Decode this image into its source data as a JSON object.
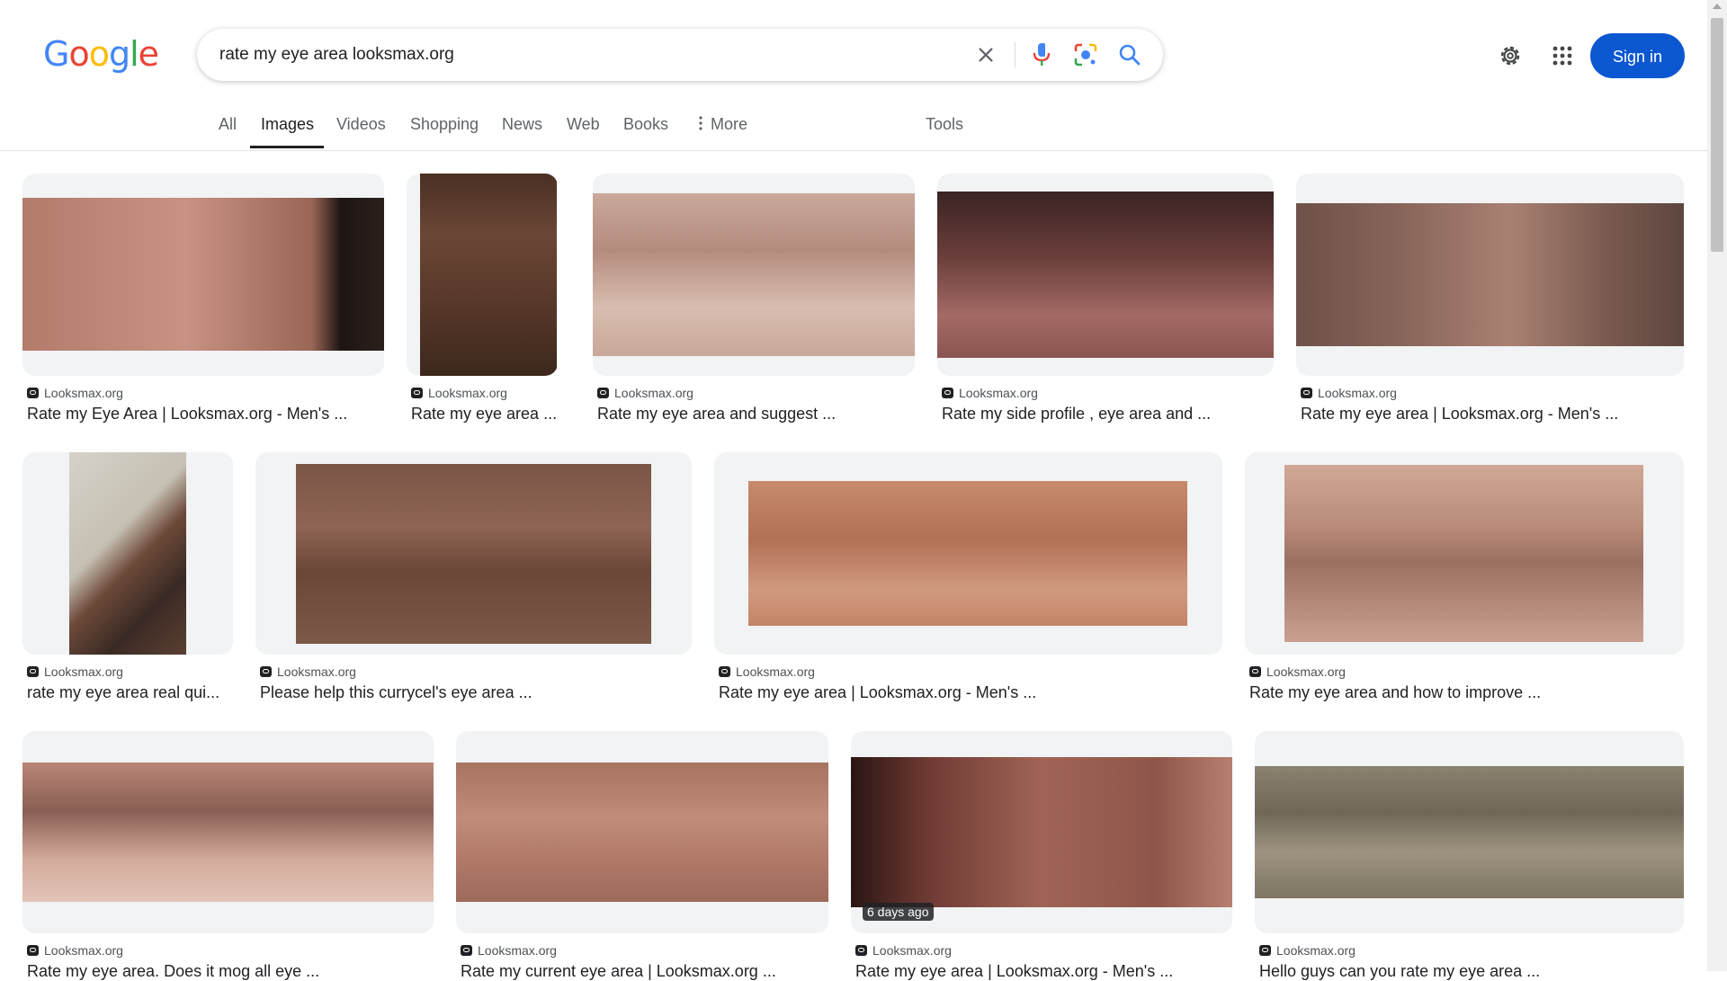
{
  "logo_text": "Google",
  "search": {
    "query": "rate my eye area looksmax.org"
  },
  "header": {
    "signin_label": "Sign in"
  },
  "tabs": [
    {
      "label": "All"
    },
    {
      "label": "Images"
    },
    {
      "label": "Videos"
    },
    {
      "label": "Shopping"
    },
    {
      "label": "News"
    },
    {
      "label": "Web"
    },
    {
      "label": "Books"
    },
    {
      "label": "More"
    },
    {
      "label": "Tools"
    }
  ],
  "results": [
    {
      "source": "Looksmax.org",
      "title": "Rate my Eye Area | Looksmax.org - Men's ..."
    },
    {
      "source": "Looksmax.org",
      "title": "Rate my eye area ..."
    },
    {
      "source": "Looksmax.org",
      "title": "Rate my eye area and suggest ..."
    },
    {
      "source": "Looksmax.org",
      "title": "Rate my side profile , eye area and ..."
    },
    {
      "source": "Looksmax.org",
      "title": "Rate my eye area | Looksmax.org - Men's ..."
    },
    {
      "source": "Looksmax.org",
      "title": "rate my eye area real qui..."
    },
    {
      "source": "Looksmax.org",
      "title": "Please help this currycel's eye area ..."
    },
    {
      "source": "Looksmax.org",
      "title": "Rate my eye area | Looksmax.org - Men's ..."
    },
    {
      "source": "Looksmax.org",
      "title": "Rate my eye area and how to improve ..."
    },
    {
      "source": "Looksmax.org",
      "title": "Rate my eye area. Does it mog all eye ..."
    },
    {
      "source": "Looksmax.org",
      "title": "Rate my current eye area | Looksmax.org ..."
    },
    {
      "source": "Looksmax.org",
      "title": "Rate my eye area | Looksmax.org - Men's ...",
      "badge": "6 days ago"
    },
    {
      "source": "Looksmax.org",
      "title": "Hello guys can you rate my eye area ..."
    }
  ],
  "colors": {
    "accent": "#0b57d0",
    "text": "#202124",
    "muted": "#5f6368"
  }
}
